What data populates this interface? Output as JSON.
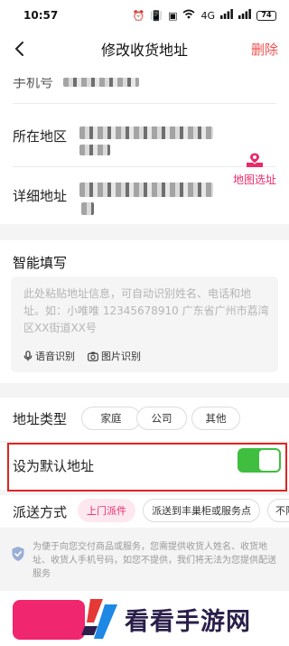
{
  "status_bar": {
    "time": "10:57",
    "network": "4G",
    "battery": "74"
  },
  "header": {
    "title": "修改收货地址",
    "delete_label": "删除"
  },
  "address_form": {
    "phone_label": "手机号",
    "region_label": "所在地区",
    "detail_label": "详细地址",
    "map_select_label": "地图选址"
  },
  "smart_fill": {
    "title": "智能填写",
    "placeholder": "此处粘贴地址信息，可自动识别姓名、电话和地址。如：小唯唯 12345678910 广东省广州市荔湾区XX街道XX号",
    "voice_label": "语音识别",
    "image_label": "图片识别"
  },
  "address_type": {
    "label": "地址类型",
    "options": [
      "家庭",
      "公司",
      "其他"
    ]
  },
  "default_address": {
    "label": "设为默认地址",
    "enabled": true
  },
  "delivery": {
    "label": "派送方式",
    "options": [
      "上门派件",
      "派送到丰巢柜或服务点",
      "不限"
    ]
  },
  "privacy_notice": "为便于向您交付商品或服务，您需提供收货人姓名、收货地址、收货人手机号码，如您不提供，我们将无法为您提供配送服务",
  "watermark": "看看手游网",
  "colors": {
    "accent": "#ea2a6b",
    "delete": "#f0504e",
    "toggle_on": "#3fbe3f",
    "highlight": "#e02424"
  }
}
